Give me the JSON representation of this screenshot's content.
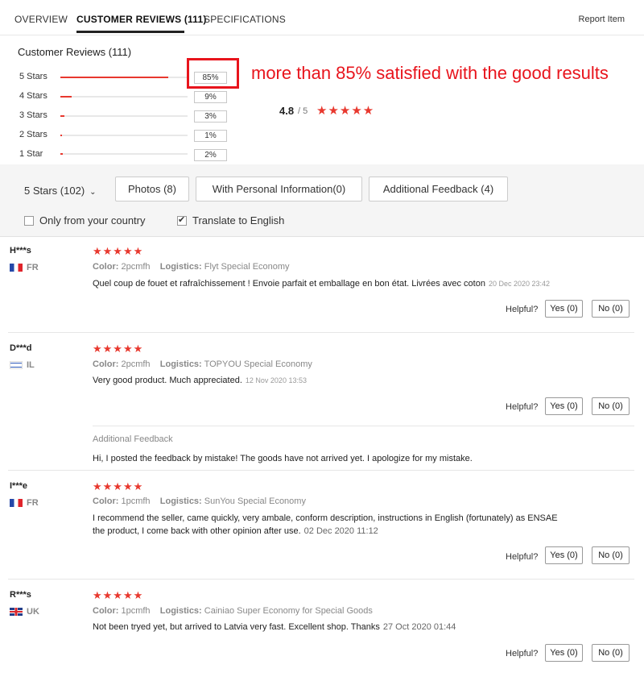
{
  "tabs": {
    "overview": "OVERVIEW",
    "reviews": "CUSTOMER REVIEWS (111)",
    "specs": "SPECIFICATIONS",
    "report": "Report Item"
  },
  "summary": {
    "title": "Customer Reviews (111)",
    "rows": [
      {
        "label": "5 Stars",
        "percent": "85%",
        "fraction": 0.85
      },
      {
        "label": "4 Stars",
        "percent": "9%",
        "fraction": 0.09
      },
      {
        "label": "3 Stars",
        "percent": "3%",
        "fraction": 0.03
      },
      {
        "label": "2 Stars",
        "percent": "1%",
        "fraction": 0.01
      },
      {
        "label": "1 Star",
        "percent": "2%",
        "fraction": 0.02
      }
    ],
    "average": "4.8",
    "average_out_of": "/ 5",
    "stars": "★★★★★",
    "annotation": "more than 85% satisfied with the good results"
  },
  "filters": {
    "star_select": "5 Stars (102)",
    "photos": "Photos (8)",
    "personal": "With Personal Information(0)",
    "additional": "Additional Feedback (4)",
    "only_country": "Only from your country",
    "translate": "Translate to English"
  },
  "labels": {
    "color": "Color:",
    "logistics": "Logistics:",
    "helpful": "Helpful?",
    "additional_feedback": "Additional Feedback"
  },
  "reviews": [
    {
      "name": "H***s",
      "country": "FR",
      "stars": "★★★★★",
      "color": "2pcmfh",
      "logistics": "Flyt Special Economy",
      "text": "Quel coup de fouet et rafraîchissement ! Envoie parfait et emballage en bon état. Livrées avec coton",
      "date": "20 Dec 2020 23:42",
      "yes": "Yes (0)",
      "no": "No (0)"
    },
    {
      "name": "D***d",
      "country": "IL",
      "stars": "★★★★★",
      "color": "2pcmfh",
      "logistics": "TOPYOU Special Economy",
      "text": "Very good product. Much appreciated.",
      "date": "12 Nov 2020 13:53",
      "yes": "Yes (0)",
      "no": "No (0)",
      "additional_text": "Hi, I posted the feedback by mistake! The goods have not arrived yet. I apologize for my mistake."
    },
    {
      "name": "I***e",
      "country": "FR",
      "stars": "★★★★★",
      "color": "1pcmfh",
      "logistics": "SunYou Special Economy",
      "text_line1": "I recommend the seller, came quickly, very ambale, conform description, instructions in English (fortunately) as ENSAE",
      "text_line2": "the product, I come back with other opinion after use.",
      "date": "02 Dec 2020 11:12",
      "yes": "Yes (0)",
      "no": "No (0)"
    },
    {
      "name": "R***s",
      "country": "UK",
      "stars": "★★★★★",
      "color": "1pcmfh",
      "logistics": "Cainiao Super Economy for Special Goods",
      "text": "Not been tryed yet, but arrived to Latvia very fast. Excellent shop. Thanks",
      "date": "27 Oct 2020 01:44",
      "yes": "Yes (0)",
      "no": "No (0)"
    }
  ],
  "colors": {
    "accent_red": "#e8382e",
    "annotation_red": "#e8141c"
  }
}
